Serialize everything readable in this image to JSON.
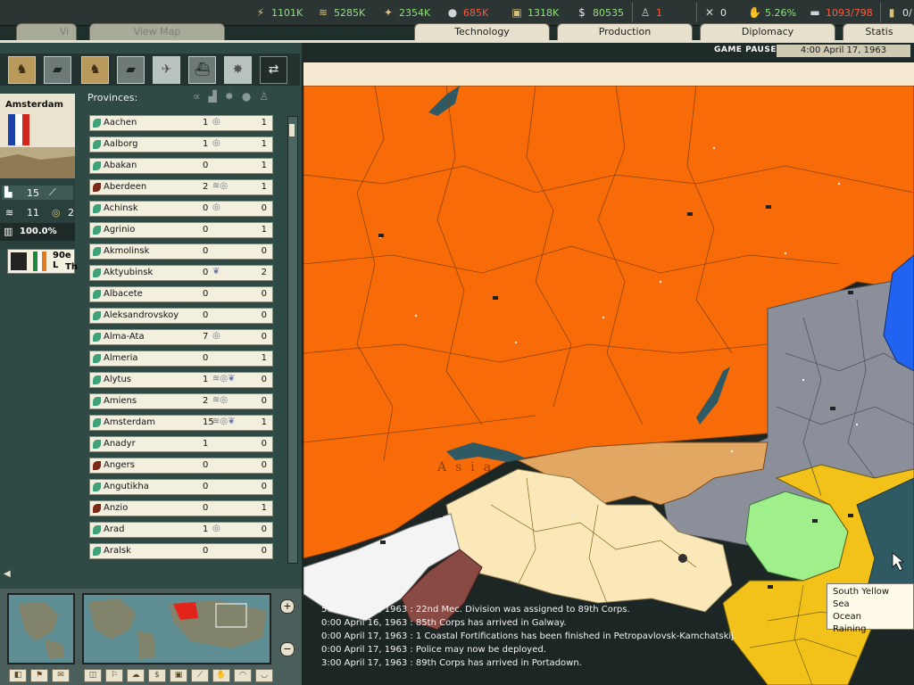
{
  "resources": [
    {
      "icon": "energy-icon",
      "value": "1101K",
      "color": "#8fe07a"
    },
    {
      "icon": "metal-icon",
      "value": "5285K",
      "color": "#8fe07a"
    },
    {
      "icon": "rare-materials-icon",
      "value": "2354K",
      "color": "#8fe07a"
    },
    {
      "icon": "oil-icon",
      "value": "685K",
      "color": "#ff5a3c"
    },
    {
      "icon": "supplies-icon",
      "value": "1318K",
      "color": "#8fe07a"
    },
    {
      "icon": "money-icon",
      "value": "80535",
      "color": "#8fe07a"
    },
    {
      "icon": "manpower-icon",
      "value": "1",
      "color": "#ff5a3c"
    },
    {
      "icon": "transport-icon",
      "value": "0",
      "color": "#e8e8e8"
    },
    {
      "icon": "dissent-icon",
      "value": "5.26%",
      "color": "#8fe07a"
    },
    {
      "icon": "convoy-icon",
      "value": "1093/798",
      "color": "#ff5a3c"
    },
    {
      "icon": "escort-icon",
      "value": "0/",
      "color": "#e8e8e8"
    }
  ],
  "tabs": {
    "left": [
      {
        "label": "Vi"
      },
      {
        "label": "View Map"
      }
    ],
    "right": [
      {
        "label": "Technology"
      },
      {
        "label": "Production"
      },
      {
        "label": "Diplomacy"
      },
      {
        "label": "Statis"
      }
    ]
  },
  "status": {
    "paused": "GAME PAUSED",
    "clock": "4:00 April 17, 1963"
  },
  "province": {
    "name": "Amsterdam",
    "stat1": "15",
    "stat2": "11",
    "stat3": "2",
    "percent": "100.0%",
    "leader_line1": "90e L",
    "leader_line2": "Th"
  },
  "list": {
    "header": "Provinces:",
    "rows": [
      {
        "name": "Aachen",
        "a": "1",
        "icons": "◎",
        "b": "1",
        "leaf": "green"
      },
      {
        "name": "Aalborg",
        "a": "1",
        "icons": "◎",
        "b": "1",
        "leaf": "green"
      },
      {
        "name": "Abakan",
        "a": "0",
        "icons": "",
        "b": "1",
        "leaf": "green"
      },
      {
        "name": "Aberdeen",
        "a": "2",
        "icons": "≋◎",
        "b": "1",
        "leaf": "brown"
      },
      {
        "name": "Achinsk",
        "a": "0",
        "icons": "◎",
        "b": "0",
        "leaf": "green"
      },
      {
        "name": "Agrinio",
        "a": "0",
        "icons": "",
        "b": "1",
        "leaf": "green"
      },
      {
        "name": "Akmolinsk",
        "a": "0",
        "icons": "",
        "b": "0",
        "leaf": "green"
      },
      {
        "name": "Aktyubinsk",
        "a": "0",
        "icons": "❦",
        "b": "2",
        "leaf": "green"
      },
      {
        "name": "Albacete",
        "a": "0",
        "icons": "",
        "b": "0",
        "leaf": "green"
      },
      {
        "name": "Aleksandrovskoy",
        "a": "0",
        "icons": "",
        "b": "0",
        "leaf": "green"
      },
      {
        "name": "Alma-Ata",
        "a": "7",
        "icons": "◎",
        "b": "0",
        "leaf": "green"
      },
      {
        "name": "Almeria",
        "a": "0",
        "icons": "",
        "b": "1",
        "leaf": "green"
      },
      {
        "name": "Alytus",
        "a": "1",
        "icons": "≋◎❦",
        "b": "0",
        "leaf": "green"
      },
      {
        "name": "Amiens",
        "a": "2",
        "icons": "≋◎",
        "b": "0",
        "leaf": "green"
      },
      {
        "name": "Amsterdam",
        "a": "15",
        "icons": "≋◎❦",
        "b": "1",
        "leaf": "green"
      },
      {
        "name": "Anadyr",
        "a": "1",
        "icons": "",
        "b": "0",
        "leaf": "green"
      },
      {
        "name": "Angers",
        "a": "0",
        "icons": "",
        "b": "0",
        "leaf": "brown"
      },
      {
        "name": "Angutikha",
        "a": "0",
        "icons": "",
        "b": "0",
        "leaf": "green"
      },
      {
        "name": "Anzio",
        "a": "0",
        "icons": "",
        "b": "1",
        "leaf": "brown"
      },
      {
        "name": "Arad",
        "a": "1",
        "icons": "◎",
        "b": "0",
        "leaf": "green"
      },
      {
        "name": "Aralsk",
        "a": "0",
        "icons": "",
        "b": "0",
        "leaf": "green"
      }
    ]
  },
  "map": {
    "region_label": "Asia",
    "colors": {
      "orange": "#f76b08",
      "grey": "#8a8f9a",
      "yellow": "#f2c21b",
      "cream": "#fbe8b8",
      "tan": "#e3a764",
      "green": "#9ff08a",
      "blue": "#1f63f0",
      "white": "#f4f4f4",
      "maroon": "#8a4a44",
      "sea": "#2f5a63"
    }
  },
  "log": [
    "5:00 April 15, 1963 : 22nd Mec. Division was assigned to 89th Corps.",
    "0:00 April 16, 1963 : 85th Corps has arrived in Galway.",
    "0:00 April 17, 1963 : 1 Coastal Fortifications has been finished in Petropavlovsk-Kamchatskij.",
    "0:00 April 17, 1963 : Police may now be deployed.",
    "3:00 April 17, 1963 : 89th Corps has arrived in Portadown."
  ],
  "tooltip": [
    "South Yellow Sea",
    "Ocean",
    "Raining"
  ]
}
